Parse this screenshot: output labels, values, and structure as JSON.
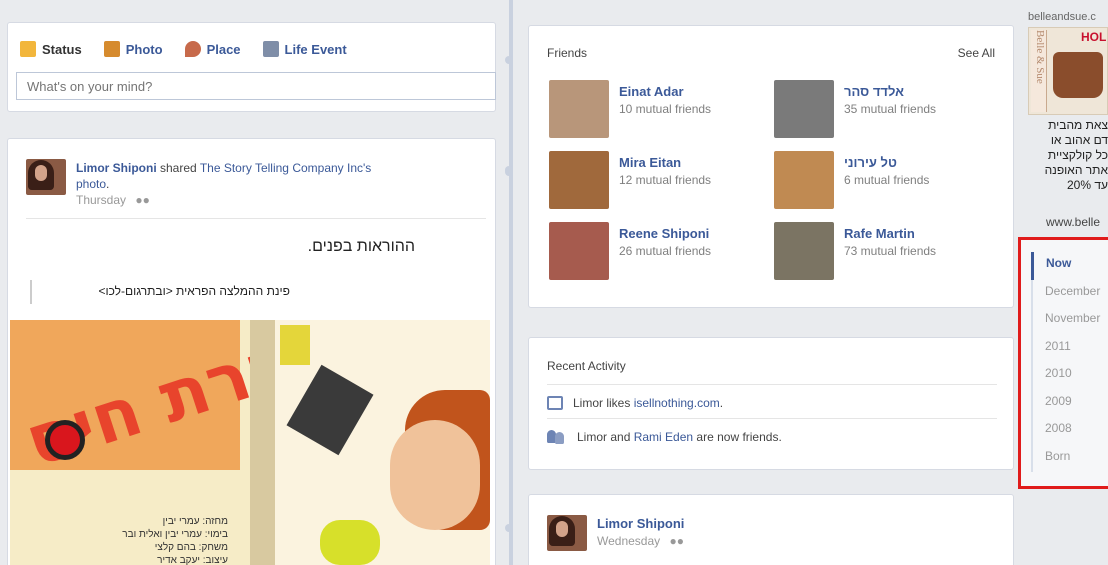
{
  "composer": {
    "tabs": [
      {
        "label": "Status",
        "icon": "status-icon",
        "color": "#f2b63c"
      },
      {
        "label": "Photo",
        "icon": "photo-icon",
        "color": "#d68b2e"
      },
      {
        "label": "Place",
        "icon": "place-icon",
        "color": "#c76a4b"
      },
      {
        "label": "Life Event",
        "icon": "life-event-icon",
        "color": "#7f8ea8"
      }
    ],
    "placeholder": "What's on your mind?"
  },
  "post": {
    "author": "Limor Shiponi",
    "action": " shared ",
    "source": "The Story Telling Company Inc's",
    "object": "photo",
    "object_suffix": ".",
    "time": "Thursday",
    "text": "ההוראות בפנים.",
    "quote": "פינת ההמלצה הפראית <ובתרגום-לכו>",
    "poster": {
      "title": "מכירת חיס",
      "credits": [
        "מחזה: עמרי יבין",
        "בימוי: עמרי יבין ואלית ובר",
        "משחק: בהם קלצי",
        "עיצוב: יעקב אדיר"
      ]
    }
  },
  "friends": {
    "header": "Friends",
    "see_all": "See All",
    "list": [
      {
        "name": "Einat Adar",
        "mutual": "10 mutual friends",
        "color": "#b8967a"
      },
      {
        "name": "אלדד סהר",
        "mutual": "35 mutual friends",
        "color": "#7a7a7a"
      },
      {
        "name": "Mira Eitan",
        "mutual": "12 mutual friends",
        "color": "#a0693c"
      },
      {
        "name": "טל עירוני",
        "mutual": "6 mutual friends",
        "color": "#c08a52"
      },
      {
        "name": "Reene Shiponi",
        "mutual": "26 mutual friends",
        "color": "#a65b4e"
      },
      {
        "name": "Rafe Martin",
        "mutual": "73 mutual friends",
        "color": "#7b7463"
      }
    ]
  },
  "recent": {
    "header": "Recent Activity",
    "item1": {
      "pre": "Limor likes ",
      "link": "isellnothing.com",
      "post": "."
    },
    "item2": {
      "pre": "Limor and ",
      "link": "Rami Eden",
      "post": " are now friends."
    }
  },
  "post2": {
    "author": "Limor Shiponi",
    "time": "Wednesday"
  },
  "ad": {
    "domain": "belleandsue.c",
    "brand_side": "Belle & Sue",
    "brand_top": "HOL",
    "lines": [
      "צאת מהבית",
      "דם אהוב או",
      "כל קולקציית",
      "אתר האופנה",
      "עד 20%"
    ],
    "url": "www.belle"
  },
  "timeline": [
    "Now",
    "December",
    "November",
    "2011",
    "2010",
    "2009",
    "2008",
    "Born"
  ],
  "colors": {
    "link": "#3b5998",
    "highlight_border": "#e01b1b"
  }
}
